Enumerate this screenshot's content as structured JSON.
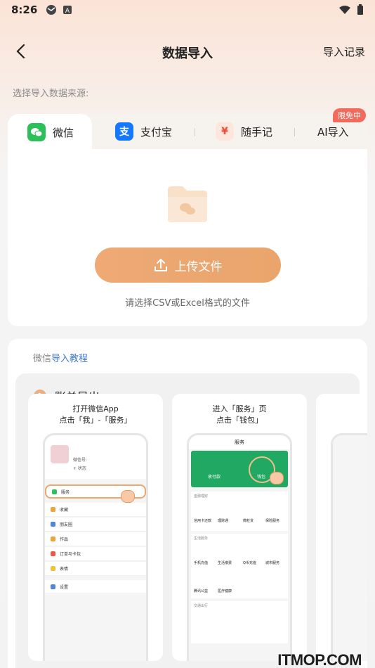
{
  "status_bar": {
    "time": "8:26"
  },
  "header": {
    "title": "数据导入",
    "action": "导入记录"
  },
  "source_label": "选择导入数据来源:",
  "tabs": [
    {
      "label": "微信",
      "icon": "wechat-icon",
      "color": "#2bc05a",
      "active": true
    },
    {
      "label": "支付宝",
      "icon": "alipay-icon",
      "color": "#1677ff",
      "active": false
    },
    {
      "label": "随手记",
      "icon": "suishouji-icon",
      "color": "#f04e3e",
      "active": false
    },
    {
      "label": "AI导入",
      "icon": "",
      "active": false
    }
  ],
  "badge": "限免中",
  "upload": {
    "button_label": "上传文件",
    "hint": "请选择CSV或Excel格式的文件"
  },
  "tutorial": {
    "prefix": "微信",
    "link": "导入教程",
    "step_number": "1",
    "step_title": "账单导出",
    "cards": [
      {
        "line1": "打开微信App",
        "line2": "点击「我」-「服务」"
      },
      {
        "line1": "进入「服务」页",
        "line2": "点击「钱包」"
      }
    ]
  },
  "mock_phone_1": {
    "menu": [
      "服务",
      "收藏",
      "朋友圈",
      "作品",
      "订单与卡包",
      "表情",
      "设置"
    ],
    "id_label": "微信号:",
    "status_label": "+ 状态"
  },
  "mock_phone_2": {
    "title": "服务",
    "pay": "收付款",
    "wallet": "钱包",
    "section1": "金融理财",
    "items1": [
      "信用卡还款",
      "理财通",
      "微粒贷",
      "保险服务"
    ],
    "section2": "生活服务",
    "items2": [
      "手机充值",
      "生活缴费",
      "Q币充值",
      "城市服务",
      "腾讯公益",
      "医疗健康"
    ],
    "section3": "交通出行"
  },
  "watermark": "ITMOP.COM",
  "colors": {
    "accent": "#eea975",
    "link": "#3d78c9",
    "badge": "#f26a5c",
    "wechat_green": "#2bc05a"
  }
}
